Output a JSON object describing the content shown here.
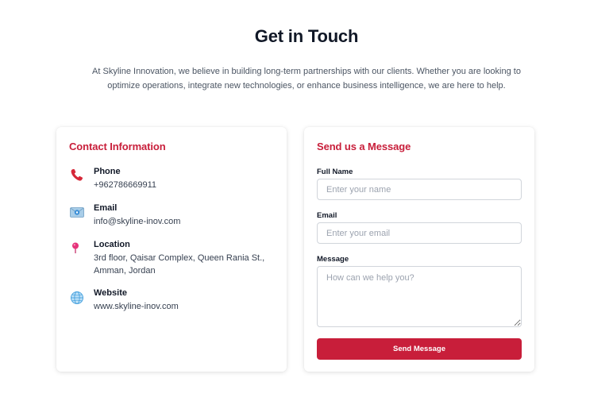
{
  "header": {
    "title": "Get in Touch",
    "intro": "At Skyline Innovation, we believe in building long-term partnerships with our clients. Whether you are looking to optimize operations, integrate new technologies, or enhance business intelligence, we are here to help."
  },
  "contact_info": {
    "title": "Contact Information",
    "items": [
      {
        "label": "Phone",
        "value": "+962786669911",
        "icon": "phone-icon"
      },
      {
        "label": "Email",
        "value": "info@skyline-inov.com",
        "icon": "email-icon"
      },
      {
        "label": "Location",
        "value": "3rd floor, Qaisar Complex, Queen Rania St., Amman, Jordan",
        "icon": "location-pin-icon"
      },
      {
        "label": "Website",
        "value": "www.skyline-inov.com",
        "icon": "globe-icon"
      }
    ]
  },
  "message_form": {
    "title": "Send us a Message",
    "name_label": "Full Name",
    "name_placeholder": "Enter your name",
    "email_label": "Email",
    "email_placeholder": "Enter your email",
    "message_label": "Message",
    "message_placeholder": "How can we help you?",
    "submit_label": "Send Message"
  },
  "colors": {
    "accent": "#c81e3a",
    "heading": "#111827",
    "body_text": "#4b5563",
    "input_border": "#d1d5db"
  }
}
